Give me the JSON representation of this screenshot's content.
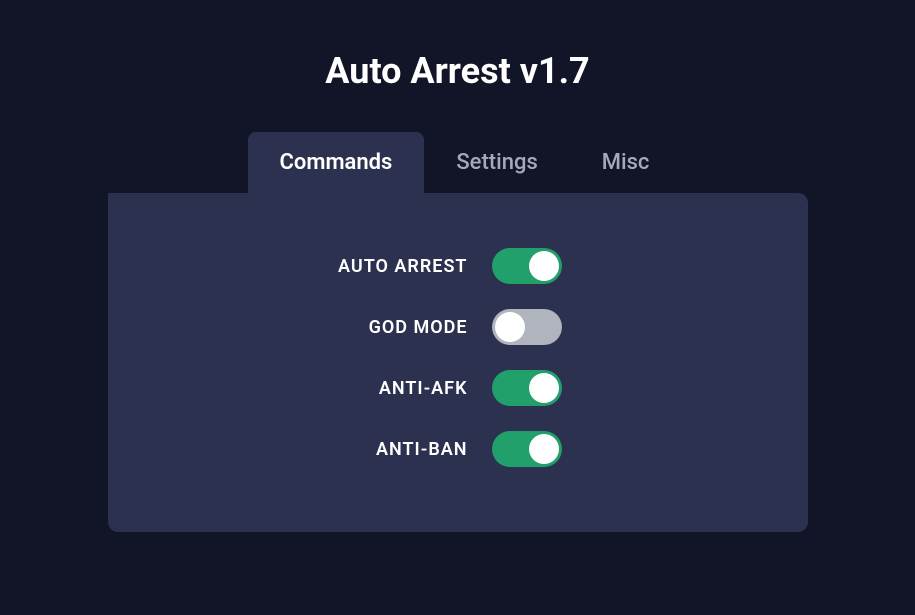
{
  "title": "Auto Arrest v1.7",
  "tabs": [
    {
      "label": "Commands",
      "active": true
    },
    {
      "label": "Settings",
      "active": false
    },
    {
      "label": "Misc",
      "active": false
    }
  ],
  "options": [
    {
      "label": "AUTO ARREST",
      "state": "on"
    },
    {
      "label": "GOD MODE",
      "state": "off"
    },
    {
      "label": "ANTI-AFK",
      "state": "on"
    },
    {
      "label": "ANTI-BAN",
      "state": "on"
    }
  ]
}
